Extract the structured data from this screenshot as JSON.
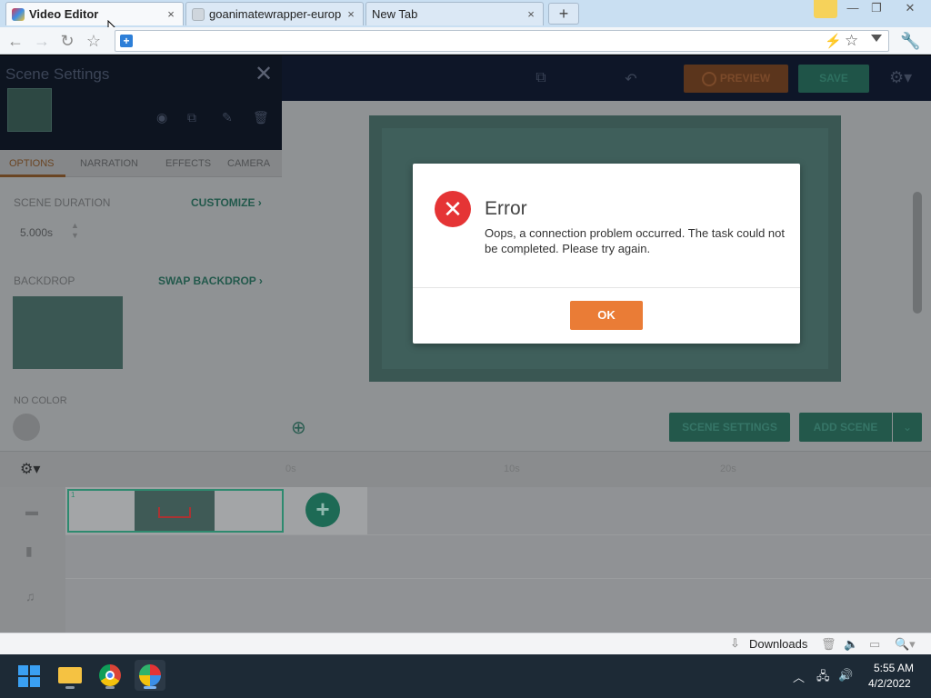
{
  "browser": {
    "tabs": [
      {
        "title": "Video Editor",
        "close": "×",
        "active": true
      },
      {
        "title": "goanimatewrapper-europ",
        "close": "×",
        "active": false
      },
      {
        "title": "New Tab",
        "close": "×",
        "active": false
      }
    ],
    "new_tab_label": "+",
    "address": ""
  },
  "app": {
    "preview_label": "PREVIEW",
    "save_label": "SAVE",
    "scene_settings_label": "SCENE SETTINGS",
    "add_scene_label": "ADD SCENE",
    "timeline_ruler": [
      "0s",
      "10s",
      "20s"
    ]
  },
  "panel": {
    "title": "Scene Settings",
    "tabs": [
      "OPTIONS",
      "NARRATION",
      "EFFECTS",
      "CAMERA"
    ],
    "active_tab": "OPTIONS",
    "scene_duration_label": "SCENE DURATION",
    "customize_label": "CUSTOMIZE",
    "duration_value": "5.000s",
    "backdrop_label": "BACKDROP",
    "swap_backdrop_label": "SWAP BACKDROP",
    "no_color_label": "NO COLOR"
  },
  "dialog": {
    "title": "Error",
    "message": "Oops, a connection problem occurred. The task could not be completed. Please try again.",
    "ok_label": "OK",
    "accent_color": "#ea7c36",
    "icon": "error-x-icon"
  },
  "statusbar": {
    "downloads_label": "Downloads"
  },
  "taskbar": {
    "time": "5:55 AM",
    "date": "4/2/2022"
  }
}
